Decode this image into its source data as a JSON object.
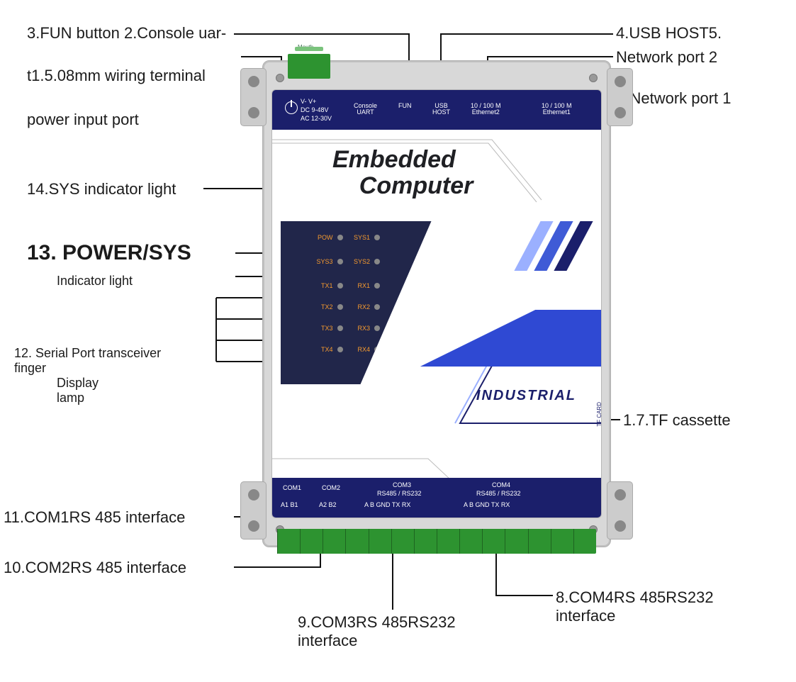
{
  "device": {
    "title_line1": "Embedded",
    "title_line2": "Computer",
    "industrial": "INDUSTRIAL",
    "tfcard": "TF CARD",
    "top_ports": {
      "power_label1": "V-   V+",
      "power_label2": "DC 9-48V",
      "power_label3": "AC 12-30V",
      "console": "Console\nUART",
      "fun": "FUN",
      "usb": "USB\nHOST",
      "eth2": "10 / 100 M\nEthernet2",
      "eth1": "10 / 100 M\nEthernet1",
      "mouth": "Mouth"
    },
    "leds": [
      {
        "l": "POW",
        "r": "SYS1"
      },
      {
        "l": "SYS3",
        "r": "SYS2"
      },
      {
        "l": "TX1",
        "r": "RX1"
      },
      {
        "l": "TX2",
        "r": "RX2"
      },
      {
        "l": "TX3",
        "r": "RX3"
      },
      {
        "l": "TX4",
        "r": "RX4"
      }
    ],
    "bottom_ports": {
      "com1": "COM1",
      "com2": "COM2",
      "com3": "COM3",
      "com4": "COM4",
      "rs": "RS485 / RS232",
      "c1p": "A1   B1",
      "c2p": "A2   B2",
      "c34p": "A    B   GND  TX    RX"
    }
  },
  "callouts": {
    "c3a": "3.FUN button 2.Console uar-",
    "c3b": "t1.5.08mm wiring terminal",
    "c3c": "power input port",
    "c4": "4.USB HOST5.",
    "c5": "Network port 2",
    "c6": "6. Network port 1",
    "c7": "1.7.TF cassette",
    "c8": "8.COM4RS 485RS232\ninterface",
    "c9": "9.COM3RS 485RS232\ninterface",
    "c10": "10.COM2RS 485 interface",
    "c11": "11.COM1RS 485 interface",
    "c12a": "12. Serial Port transceiver",
    "c12b": "finger",
    "c12c": "Display\nlamp",
    "c13": "13. POWER/SYS",
    "c13b": "Indicator light",
    "c14": "14.SYS indicator light"
  }
}
